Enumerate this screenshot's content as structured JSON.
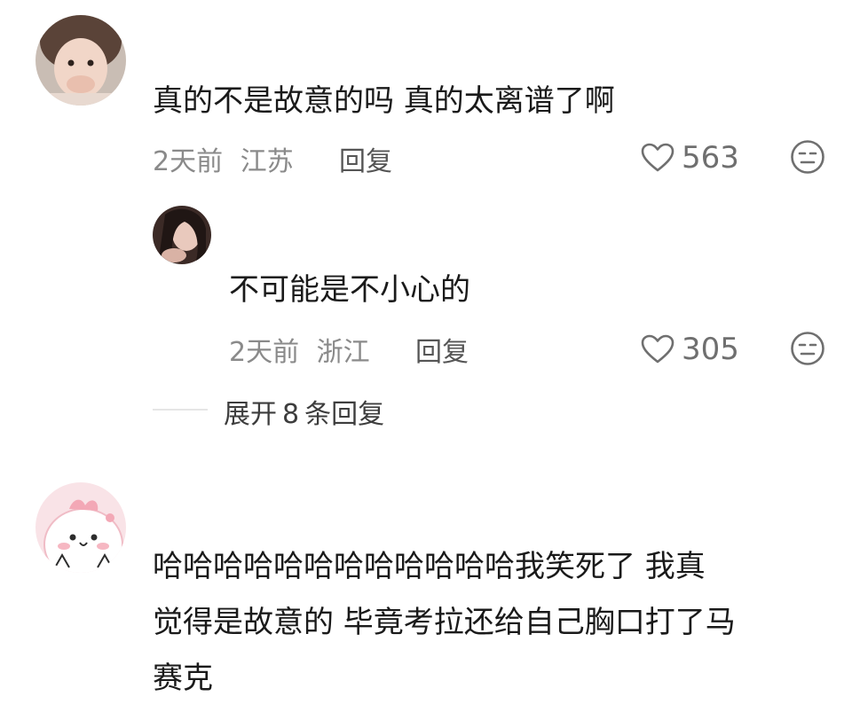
{
  "comments": [
    {
      "text": "真的不是故意的吗 真的太离谱了啊",
      "time": "2天前",
      "location": "江苏",
      "reply_label": "回复",
      "likes": "563",
      "avatar_icon": "girl-photo-avatar",
      "replies": [
        {
          "text": "不可能是不小心的",
          "time": "2天前",
          "location": "浙江",
          "reply_label": "回复",
          "likes": "305",
          "avatar_icon": "woman-photo-avatar"
        }
      ],
      "expand": {
        "prefix": "展开",
        "count": "8",
        "suffix": "条回复"
      }
    },
    {
      "text_lines": [
        "哈哈哈哈哈哈哈哈哈哈哈哈我笑死了 我真",
        "觉得是故意的 毕竟考拉还给自己胸口打了马",
        "赛克"
      ],
      "avatar_icon": "pink-cartoon-avatar"
    }
  ],
  "colors": {
    "meta": "#8a8a8a",
    "text": "#1a1a1a",
    "icon": "#6f6f6f",
    "avatar_pink": "#f7d6dc"
  }
}
